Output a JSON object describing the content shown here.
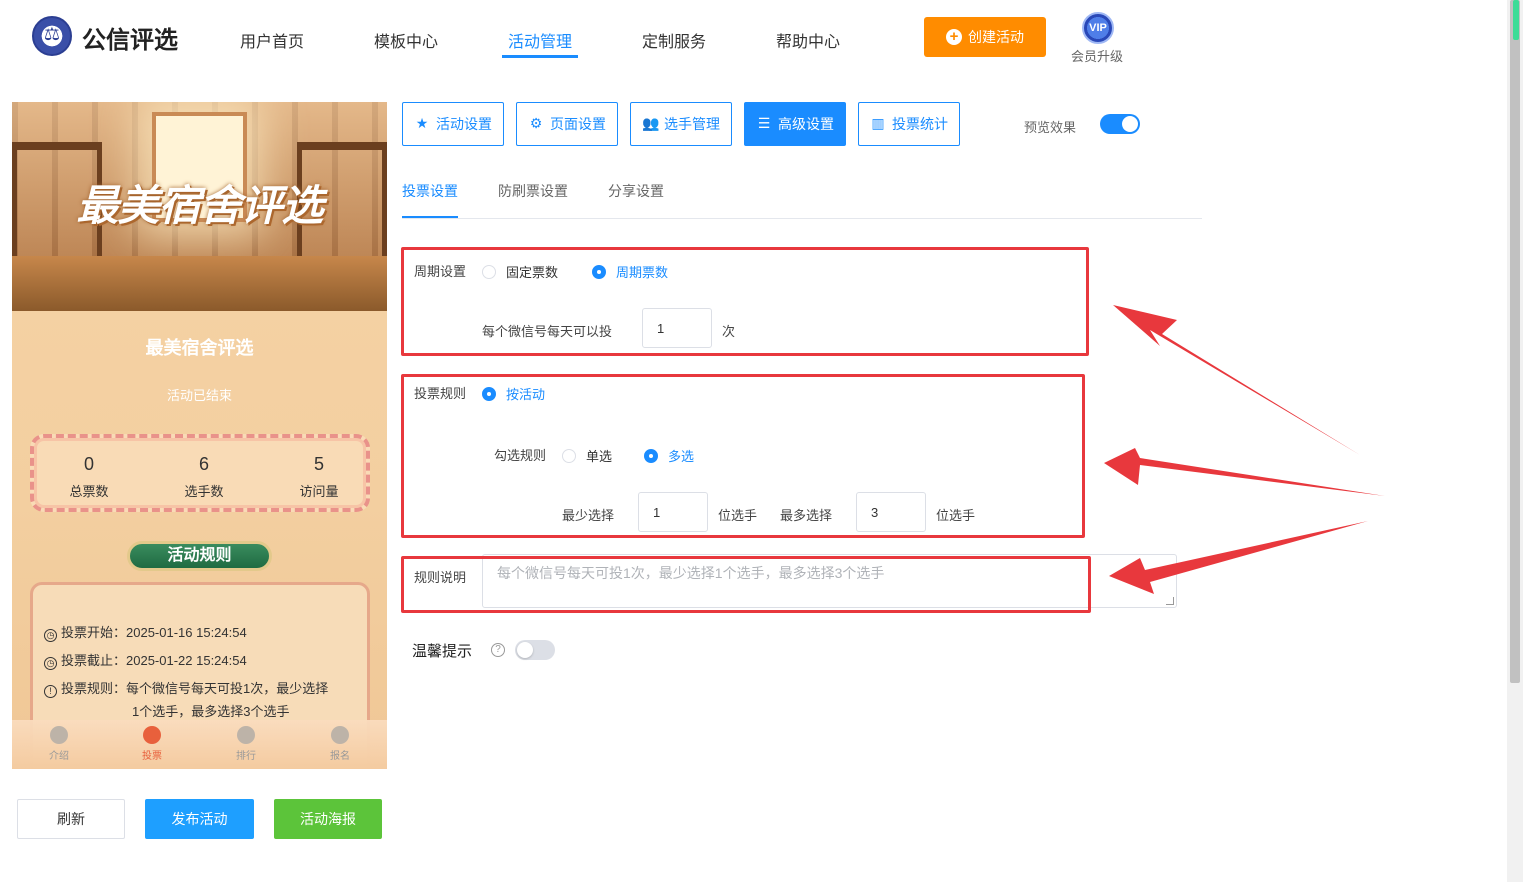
{
  "header": {
    "brand": "公信评选",
    "nav": [
      {
        "label": "用户首页"
      },
      {
        "label": "模板中心"
      },
      {
        "label": "活动管理"
      },
      {
        "label": "定制服务"
      },
      {
        "label": "帮助中心"
      }
    ],
    "create_button": "创建活动",
    "vip_badge": "VIP",
    "vip_label": "会员升级"
  },
  "preview": {
    "banner_title": "最美宿舍评选",
    "activity_name": "最美宿舍评选",
    "status": "活动已结束",
    "stats": [
      {
        "value": "0",
        "label": "总票数"
      },
      {
        "value": "6",
        "label": "选手数"
      },
      {
        "value": "5",
        "label": "访问量"
      }
    ],
    "rules_title": "活动规则",
    "rules": [
      {
        "icon": "clock-icon",
        "text": "投票开始：2025-01-16 15:24:54"
      },
      {
        "icon": "clock-icon",
        "text": "投票截止：2025-01-22 15:24:54"
      },
      {
        "icon": "info-icon",
        "text": "投票规则：每个微信号每天可投1次，最少选择"
      },
      {
        "icon": "",
        "text": "1个选手，最多选择3个选手"
      }
    ],
    "tabs": [
      {
        "label": "介绍",
        "active": false
      },
      {
        "label": "投票",
        "active": true
      },
      {
        "label": "排行",
        "active": false
      },
      {
        "label": "报名",
        "active": false
      }
    ]
  },
  "bottom_buttons": {
    "refresh": "刷新",
    "publish": "发布活动",
    "poster": "活动海报"
  },
  "settings_tabs": [
    {
      "label": "活动设置",
      "icon": "star-icon"
    },
    {
      "label": "页面设置",
      "icon": "gear-icon"
    },
    {
      "label": "选手管理",
      "icon": "users-icon"
    },
    {
      "label": "高级设置",
      "icon": "sliders-icon",
      "active": true
    },
    {
      "label": "投票统计",
      "icon": "bar-chart-icon"
    }
  ],
  "preview_toggle": {
    "label": "预览效果",
    "on": true
  },
  "sub_tabs": [
    "投票设置",
    "防刷票设置",
    "分享设置"
  ],
  "form": {
    "cycle_label": "周期设置",
    "cycle_options": [
      "固定票数",
      "周期票数"
    ],
    "cycle_selected": "周期票数",
    "per_day_label": "每个微信号每天可以投",
    "per_day_value": "1",
    "per_day_unit": "次",
    "vote_rule_label": "投票规则",
    "vote_rule_option": "按活动",
    "check_rule_label": "勾选规则",
    "check_options": [
      "单选",
      "多选"
    ],
    "check_selected": "多选",
    "min_label": "最少选择",
    "min_value": "1",
    "min_unit": "位选手",
    "max_label": "最多选择",
    "max_value": "3",
    "max_unit": "位选手",
    "desc_label": "规则说明",
    "desc_placeholder": "每个微信号每天可投1次，最少选择1个选手，最多选择3个选手",
    "tip_label": "温馨提示",
    "tip_on": false
  },
  "colors": {
    "primary": "#1a8cff",
    "orange": "#ff8c00",
    "green": "#5cc43a",
    "publish": "#1e9fff",
    "annotation_red": "#e8383d"
  }
}
